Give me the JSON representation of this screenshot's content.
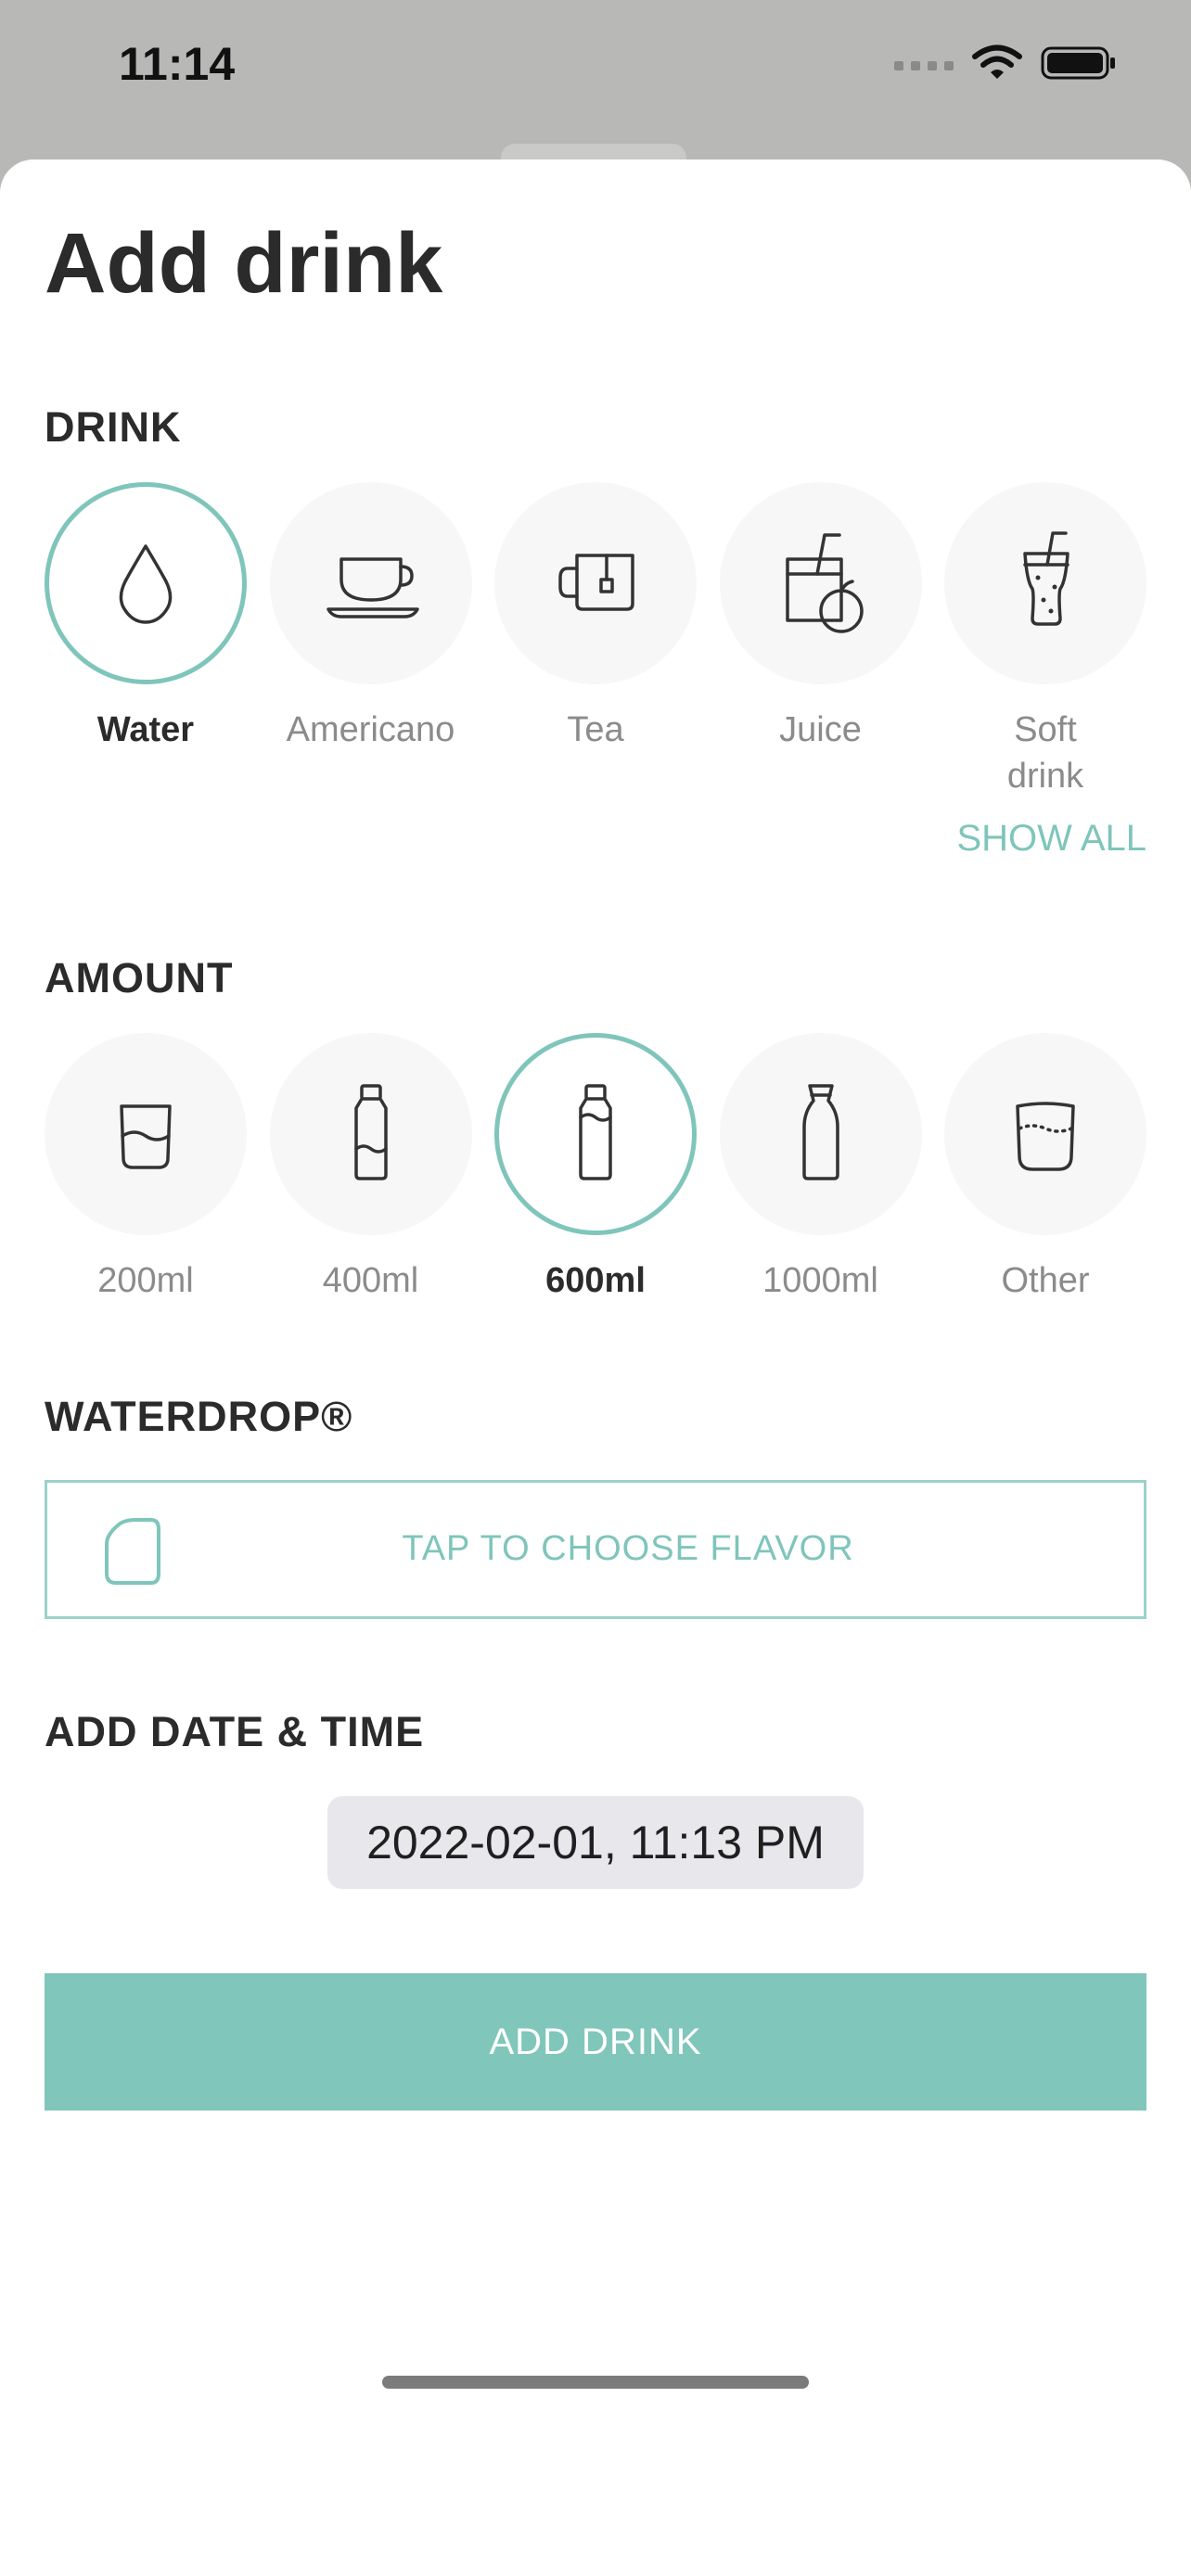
{
  "status_bar": {
    "time": "11:14"
  },
  "title": "Add drink",
  "sections": {
    "drink": "DRINK",
    "amount": "AMOUNT",
    "waterdrop": "WATERDROP®",
    "datetime": "ADD DATE & TIME"
  },
  "drinks": [
    {
      "label": "Water",
      "icon": "water-drop-icon",
      "selected": true
    },
    {
      "label": "Americano",
      "icon": "coffee-cup-icon",
      "selected": false
    },
    {
      "label": "Tea",
      "icon": "tea-mug-icon",
      "selected": false
    },
    {
      "label": "Juice",
      "icon": "juice-glass-icon",
      "selected": false
    },
    {
      "label": "Soft drink",
      "icon": "soft-drink-icon",
      "selected": false
    }
  ],
  "show_all": "SHOW ALL",
  "amounts": [
    {
      "label": "200ml",
      "icon": "small-glass-icon",
      "selected": false
    },
    {
      "label": "400ml",
      "icon": "small-bottle-icon",
      "selected": false
    },
    {
      "label": "600ml",
      "icon": "bottle-icon",
      "selected": true
    },
    {
      "label": "1000ml",
      "icon": "carafe-icon",
      "selected": false
    },
    {
      "label": "Other",
      "icon": "glass-other-icon",
      "selected": false
    }
  ],
  "flavor": {
    "label": "TAP TO CHOOSE FLAVOR",
    "icon": "flavor-cube-icon"
  },
  "datetime_value": "2022-02-01, 11:13 PM",
  "add_button": "ADD DRINK",
  "colors": {
    "accent": "#80c6bb",
    "text": "#2b2b2b",
    "muted": "#8b8b8b"
  }
}
